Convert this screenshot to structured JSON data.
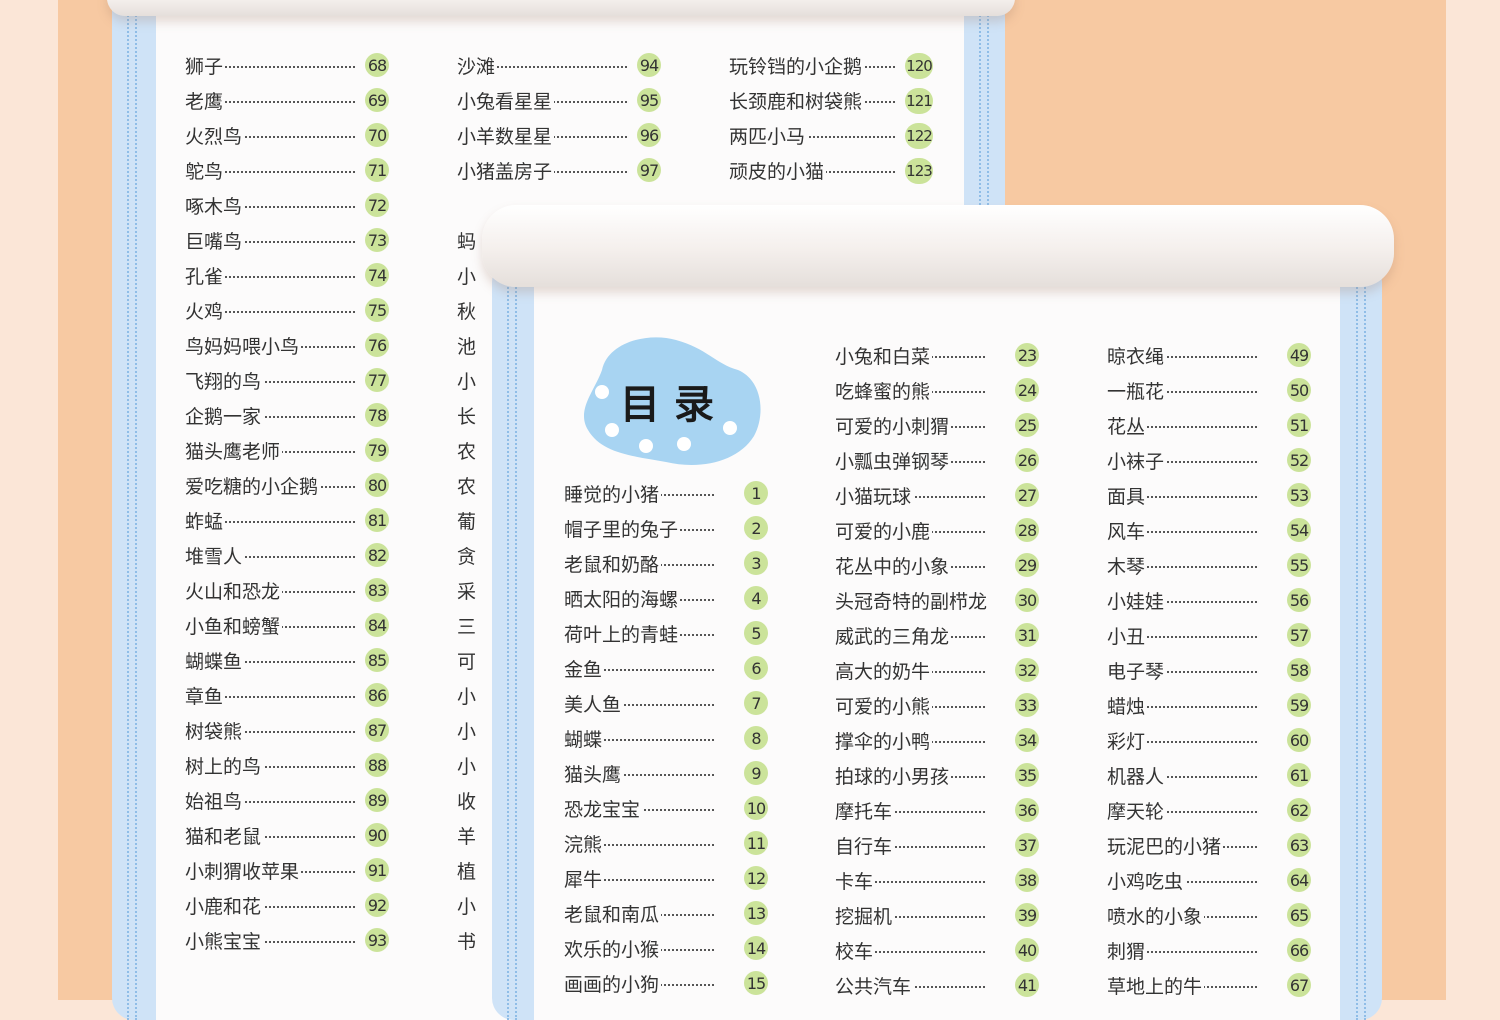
{
  "colors": {
    "badge": "#cbe39a",
    "sheet": "#cfe3f7",
    "background": "#f7c9a2",
    "blob": "#a8d4f2"
  },
  "title": "目录",
  "back": {
    "col1": [
      {
        "t": "狮子",
        "n": "68"
      },
      {
        "t": "老鹰",
        "n": "69"
      },
      {
        "t": "火烈鸟",
        "n": "70"
      },
      {
        "t": "鸵鸟",
        "n": "71"
      },
      {
        "t": "啄木鸟",
        "n": "72"
      },
      {
        "t": "巨嘴鸟",
        "n": "73"
      },
      {
        "t": "孔雀",
        "n": "74"
      },
      {
        "t": "火鸡",
        "n": "75"
      },
      {
        "t": "鸟妈妈喂小鸟",
        "n": "76"
      },
      {
        "t": "飞翔的鸟",
        "n": "77"
      },
      {
        "t": "企鹅一家",
        "n": "78"
      },
      {
        "t": "猫头鹰老师",
        "n": "79"
      },
      {
        "t": "爱吃糖的小企鹅",
        "n": "80"
      },
      {
        "t": "蚱蜢",
        "n": "81"
      },
      {
        "t": "堆雪人",
        "n": "82"
      },
      {
        "t": "火山和恐龙",
        "n": "83"
      },
      {
        "t": "小鱼和螃蟹",
        "n": "84"
      },
      {
        "t": "蝴蝶鱼",
        "n": "85"
      },
      {
        "t": "章鱼",
        "n": "86"
      },
      {
        "t": "树袋熊",
        "n": "87"
      },
      {
        "t": "树上的鸟",
        "n": "88"
      },
      {
        "t": "始祖鸟",
        "n": "89"
      },
      {
        "t": "猫和老鼠",
        "n": "90"
      },
      {
        "t": "小刺猬收苹果",
        "n": "91"
      },
      {
        "t": "小鹿和花",
        "n": "92"
      },
      {
        "t": "小熊宝宝",
        "n": "93"
      }
    ],
    "col2": [
      {
        "t": "沙滩",
        "n": "94"
      },
      {
        "t": "小兔看星星",
        "n": "95"
      },
      {
        "t": "小羊数星星",
        "n": "96"
      },
      {
        "t": "小猪盖房子",
        "n": "97"
      }
    ],
    "col2_partial": [
      "蚂",
      "小",
      "秋",
      "池",
      "小",
      "长",
      "农",
      "农",
      "葡",
      "贪",
      "采",
      "三",
      "可",
      "小",
      "小",
      "小",
      "收",
      "羊",
      "植",
      "小",
      "书"
    ],
    "col3": [
      {
        "t": "玩铃铛的小企鹅",
        "n": "120"
      },
      {
        "t": "长颈鹿和树袋熊",
        "n": "121"
      },
      {
        "t": "两匹小马",
        "n": "122"
      },
      {
        "t": "顽皮的小猫",
        "n": "123"
      }
    ]
  },
  "front": {
    "col1": [
      {
        "t": "睡觉的小猪",
        "n": "1"
      },
      {
        "t": "帽子里的兔子",
        "n": "2"
      },
      {
        "t": "老鼠和奶酪",
        "n": "3"
      },
      {
        "t": "晒太阳的海螺",
        "n": "4"
      },
      {
        "t": "荷叶上的青蛙",
        "n": "5"
      },
      {
        "t": "金鱼",
        "n": "6"
      },
      {
        "t": "美人鱼",
        "n": "7"
      },
      {
        "t": "蝴蝶",
        "n": "8"
      },
      {
        "t": "猫头鹰",
        "n": "9"
      },
      {
        "t": "恐龙宝宝",
        "n": "10"
      },
      {
        "t": "浣熊",
        "n": "11"
      },
      {
        "t": "犀牛",
        "n": "12"
      },
      {
        "t": "老鼠和南瓜",
        "n": "13"
      },
      {
        "t": "欢乐的小猴",
        "n": "14"
      },
      {
        "t": "画画的小狗",
        "n": "15"
      }
    ],
    "col2": [
      {
        "t": "小兔和白菜",
        "n": "23"
      },
      {
        "t": "吃蜂蜜的熊",
        "n": "24"
      },
      {
        "t": "可爱的小刺猬",
        "n": "25"
      },
      {
        "t": "小瓢虫弹钢琴",
        "n": "26"
      },
      {
        "t": "小猫玩球",
        "n": "27"
      },
      {
        "t": "可爱的小鹿",
        "n": "28"
      },
      {
        "t": "花丛中的小象",
        "n": "29"
      },
      {
        "t": "头冠奇特的副栉龙",
        "n": "30"
      },
      {
        "t": "威武的三角龙",
        "n": "31"
      },
      {
        "t": "高大的奶牛",
        "n": "32"
      },
      {
        "t": "可爱的小熊",
        "n": "33"
      },
      {
        "t": "撑伞的小鸭",
        "n": "34"
      },
      {
        "t": "拍球的小男孩",
        "n": "35"
      },
      {
        "t": "摩托车",
        "n": "36"
      },
      {
        "t": "自行车",
        "n": "37"
      },
      {
        "t": "卡车",
        "n": "38"
      },
      {
        "t": "挖掘机",
        "n": "39"
      },
      {
        "t": "校车",
        "n": "40"
      },
      {
        "t": "公共汽车",
        "n": "41"
      }
    ],
    "col3": [
      {
        "t": "晾衣绳",
        "n": "49"
      },
      {
        "t": "一瓶花",
        "n": "50"
      },
      {
        "t": "花丛",
        "n": "51"
      },
      {
        "t": "小袜子",
        "n": "52"
      },
      {
        "t": "面具",
        "n": "53"
      },
      {
        "t": "风车",
        "n": "54"
      },
      {
        "t": "木琴",
        "n": "55"
      },
      {
        "t": "小娃娃",
        "n": "56"
      },
      {
        "t": "小丑",
        "n": "57"
      },
      {
        "t": "电子琴",
        "n": "58"
      },
      {
        "t": "蜡烛",
        "n": "59"
      },
      {
        "t": "彩灯",
        "n": "60"
      },
      {
        "t": "机器人",
        "n": "61"
      },
      {
        "t": "摩天轮",
        "n": "62"
      },
      {
        "t": "玩泥巴的小猪",
        "n": "63"
      },
      {
        "t": "小鸡吃虫",
        "n": "64"
      },
      {
        "t": "喷水的小象",
        "n": "65"
      },
      {
        "t": "刺猬",
        "n": "66"
      },
      {
        "t": "草地上的牛",
        "n": "67"
      }
    ]
  }
}
